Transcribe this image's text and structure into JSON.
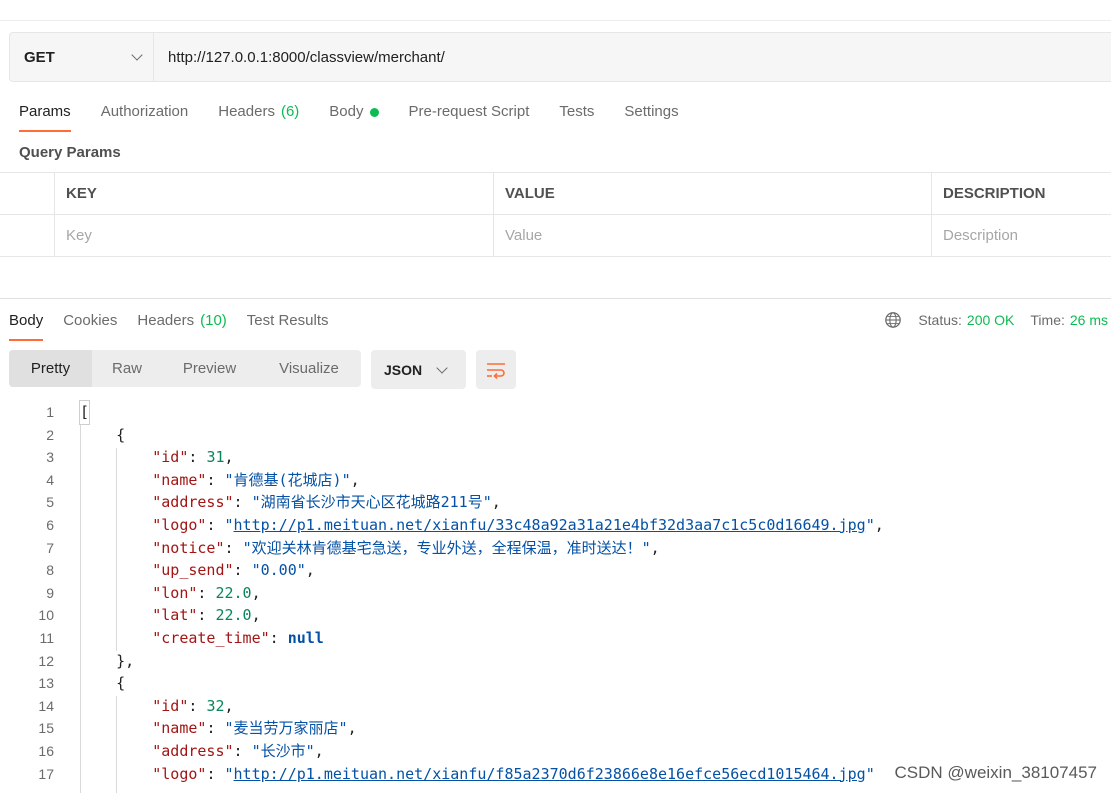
{
  "request": {
    "method": "GET",
    "url": "http://127.0.0.1:8000/classview/merchant/"
  },
  "request_tabs": {
    "params": "Params",
    "authorization": "Authorization",
    "headers": "Headers",
    "headers_count": "(6)",
    "body": "Body",
    "prerequest": "Pre-request Script",
    "tests": "Tests",
    "settings": "Settings"
  },
  "query_params": {
    "title": "Query Params",
    "headers": {
      "key": "KEY",
      "value": "VALUE",
      "description": "DESCRIPTION"
    },
    "placeholders": {
      "key": "Key",
      "value": "Value",
      "description": "Description"
    }
  },
  "response_tabs": {
    "body": "Body",
    "cookies": "Cookies",
    "headers": "Headers",
    "headers_count": "(10)",
    "test_results": "Test Results"
  },
  "status": {
    "status_label": "Status:",
    "status_value": "200 OK",
    "time_label": "Time:",
    "time_value": "26 ms"
  },
  "view_modes": {
    "pretty": "Pretty",
    "raw": "Raw",
    "preview": "Preview",
    "visualize": "Visualize",
    "format": "JSON"
  },
  "code": {
    "line_numbers": [
      "1",
      "2",
      "3",
      "4",
      "5",
      "6",
      "7",
      "8",
      "9",
      "10",
      "11",
      "12",
      "13",
      "14",
      "15",
      "16",
      "17"
    ],
    "tokens": {
      "l1": "[",
      "l2": "{",
      "l3_key": "\"id\"",
      "l3_val": "31",
      "l4_key": "\"name\"",
      "l4_val": "\"肯德基(花城店)\"",
      "l5_key": "\"address\"",
      "l5_val": "\"湖南省长沙市天心区花城路211号\"",
      "l6_key": "\"logo\"",
      "l6_url": "http://p1.meituan.net/xianfu/33c48a92a31a21e4bf32d3aa7c1c5c0d16649.jpg",
      "l7_key": "\"notice\"",
      "l7_val": "\"欢迎关林肯德基宅急送，专业外送，全程保温，准时送达！\"",
      "l8_key": "\"up_send\"",
      "l8_val": "\"0.00\"",
      "l9_key": "\"lon\"",
      "l9_val": "22.0",
      "l10_key": "\"lat\"",
      "l10_val": "22.0",
      "l11_key": "\"create_time\"",
      "l11_val": "null",
      "l12": "},",
      "l13": "{",
      "l14_key": "\"id\"",
      "l14_val": "32",
      "l15_key": "\"name\"",
      "l15_val": "\"麦当劳万家丽店\"",
      "l16_key": "\"address\"",
      "l16_val": "\"长沙市\"",
      "l17_key": "\"logo\"",
      "l17_url": "http://p1.meituan.net/xianfu/f85a2370d6f23866e8e16efce56ecd1015464.jpg"
    }
  },
  "watermark": "CSDN @weixin_38107457",
  "colors": {
    "accent": "#ff6c37",
    "success": "#0cbb52",
    "json_key": "#a31515",
    "json_string": "#0451a5",
    "json_number": "#098658"
  },
  "icons": {
    "method_dropdown": "chevron-down-icon",
    "format_dropdown": "chevron-down-icon",
    "wrap": "text-wrap-icon",
    "network": "globe-icon",
    "body_indicator": "dot-icon"
  }
}
